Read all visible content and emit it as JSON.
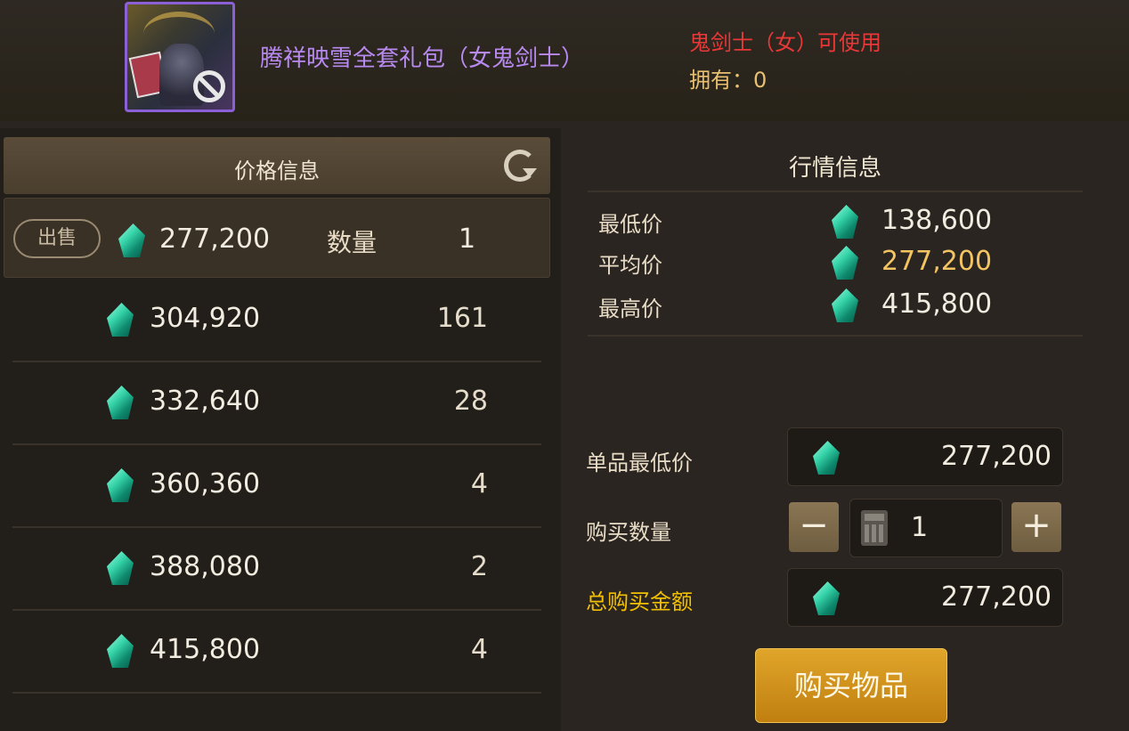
{
  "item": {
    "name": "腾祥映雪全套礼包（女鬼剑士）",
    "usable_text": "鬼剑士（女）可使用",
    "owned_text": "拥有：0"
  },
  "price_panel": {
    "title": "价格信息",
    "selected": {
      "sell_label": "出售",
      "price": "277,200",
      "qty_label": "数量",
      "qty": "1"
    },
    "rows": [
      {
        "price": "304,920",
        "qty": "161"
      },
      {
        "price": "332,640",
        "qty": "28"
      },
      {
        "price": "360,360",
        "qty": "4"
      },
      {
        "price": "388,080",
        "qty": "2"
      },
      {
        "price": "415,800",
        "qty": "4"
      }
    ]
  },
  "market_panel": {
    "title": "行情信息",
    "stats": [
      {
        "label": "最低价",
        "value": "138,600"
      },
      {
        "label": "平均价",
        "value": "277,200"
      },
      {
        "label": "最高价",
        "value": "415,800"
      }
    ]
  },
  "purchase": {
    "unit_min_label": "单品最低价",
    "unit_min_value": "277,200",
    "qty_label": "购买数量",
    "qty_value": "1",
    "minus_label": "−",
    "plus_label": "+",
    "total_label": "总购买金额",
    "total_value": "277,200",
    "buy_label": "购买物品"
  },
  "colors": {
    "item_name": "#b88af0",
    "usable": "#e83838",
    "owned": "#e8c070",
    "avg_price": "#f2c462",
    "total_label": "#f2c000",
    "buy_button": "#d4921c",
    "icon_border": "#8b5fd6"
  },
  "icons": [
    "item-icon",
    "forbidden-icon",
    "refresh-icon",
    "gem-icon",
    "calculator-icon"
  ]
}
